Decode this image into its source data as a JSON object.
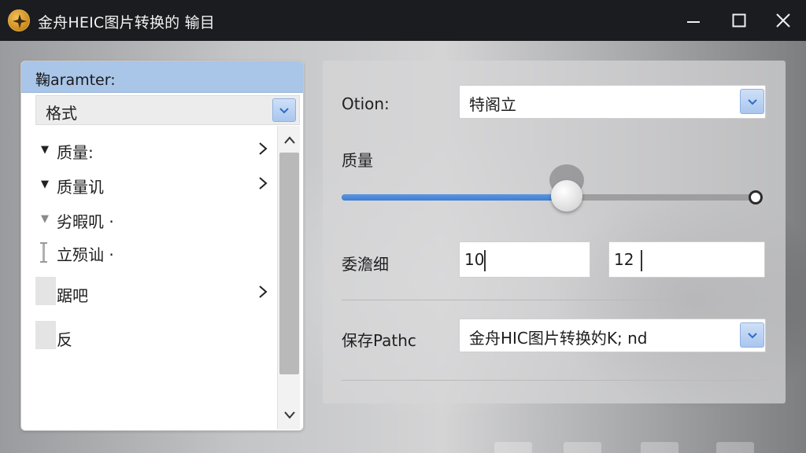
{
  "titlebar": {
    "title": "金舟HEIC图片转换的 输目"
  },
  "left_panel": {
    "header": "鞠aramter:",
    "format_label": "格式",
    "items": [
      {
        "label": "质量:",
        "expander": "▼",
        "has_chevron": true
      },
      {
        "label": "质量讥",
        "expander": "▼",
        "has_chevron": true
      },
      {
        "label": "劣暇叽 ·",
        "expander": "▼",
        "has_chevron": false
      },
      {
        "label": "立殒讪 ·",
        "has_chevron": false
      },
      {
        "label": "踞吧",
        "has_chevron": true
      },
      {
        "label": "反",
        "has_chevron": false
      }
    ]
  },
  "right_panel": {
    "option_label": "Otion:",
    "option_value": "特阁立",
    "quality_label": "质量",
    "quality_slider_percent": 54.5,
    "size_label": "委澹细",
    "width_value": "10",
    "height_value": "12",
    "save_path_label": "保存Pathc",
    "save_path_value": "金舟HIC图片转换妁K;  nd"
  },
  "colors": {
    "accent_blue": "#4a88d8",
    "header_blue": "#a9c5e8",
    "titlebar": "#1b1c20"
  }
}
